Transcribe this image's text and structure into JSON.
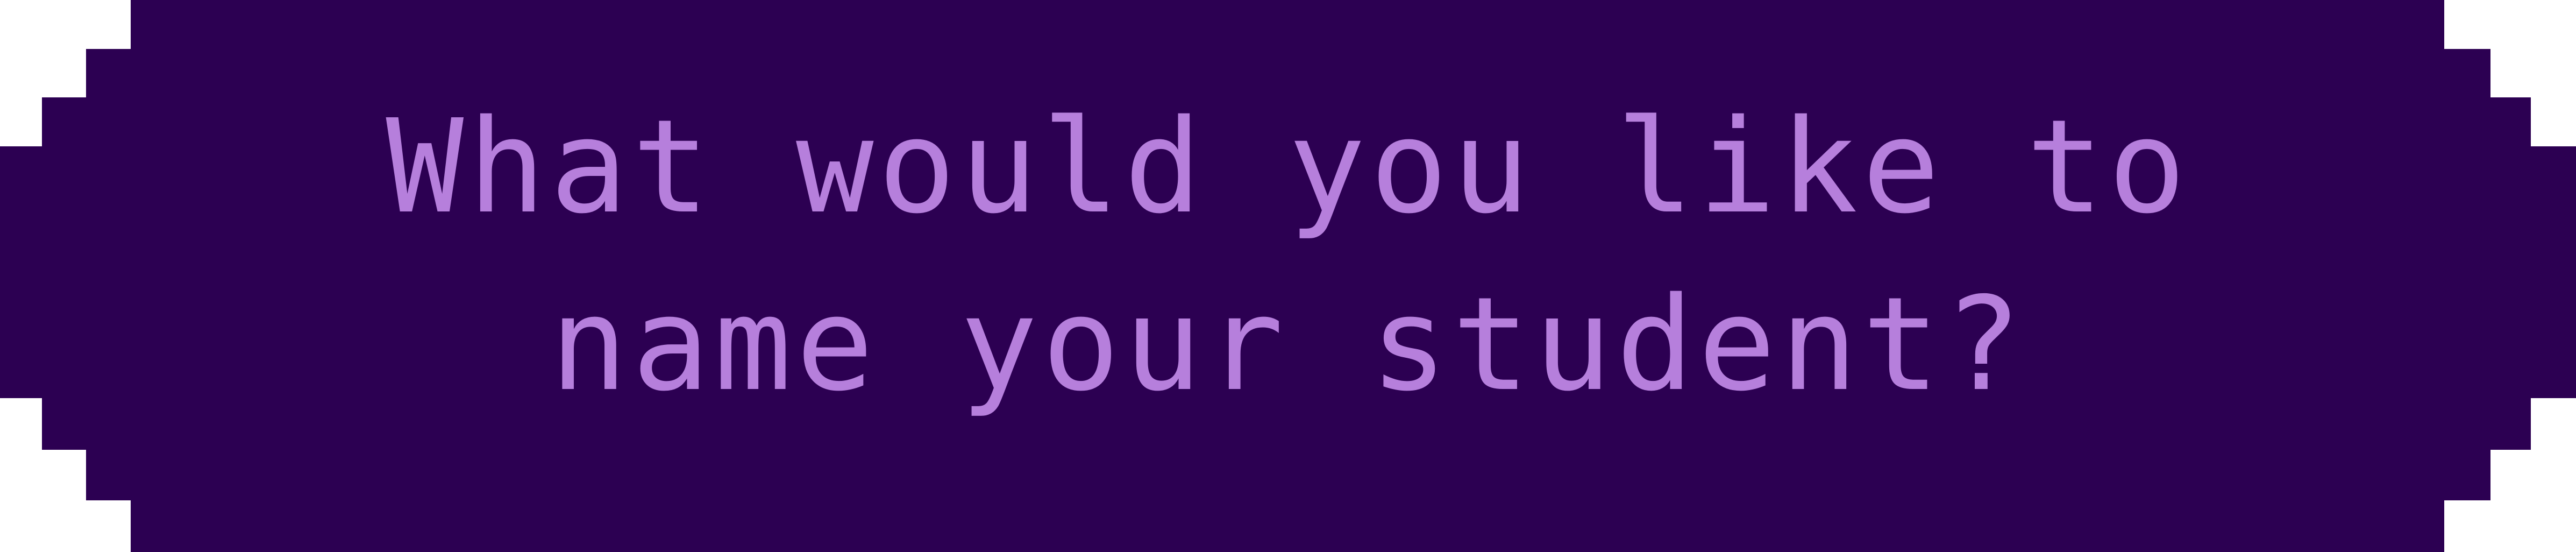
{
  "dialog": {
    "line1": "What would you like to",
    "line2": "name your student?"
  },
  "colors": {
    "panel_background": "#2c0052",
    "text": "#b67fdc",
    "page_background": "#ffffff"
  }
}
